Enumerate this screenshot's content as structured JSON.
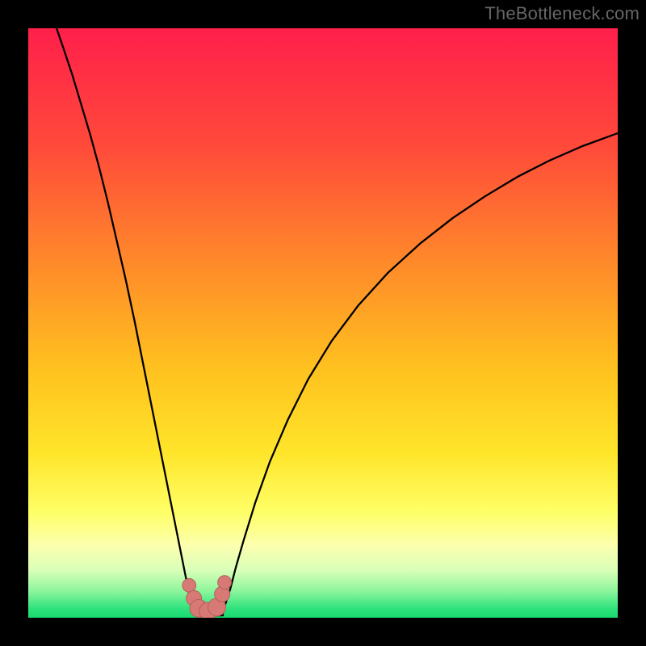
{
  "watermark": "TheBottleneck.com",
  "colors": {
    "background": "#000000",
    "watermark": "#666666",
    "curve": "#000000",
    "marker_fill": "#D77A76",
    "marker_stroke": "#B75E5A",
    "gradient_stops": [
      {
        "offset": 0.0,
        "color": "#FF1F4B"
      },
      {
        "offset": 0.2,
        "color": "#FF4A3A"
      },
      {
        "offset": 0.4,
        "color": "#FF8A2A"
      },
      {
        "offset": 0.58,
        "color": "#FFC21F"
      },
      {
        "offset": 0.72,
        "color": "#FFE52A"
      },
      {
        "offset": 0.82,
        "color": "#FFFF66"
      },
      {
        "offset": 0.88,
        "color": "#FBFFB0"
      },
      {
        "offset": 0.92,
        "color": "#D8FFB8"
      },
      {
        "offset": 0.955,
        "color": "#8CF59C"
      },
      {
        "offset": 0.985,
        "color": "#2EE27C"
      },
      {
        "offset": 1.0,
        "color": "#18D96F"
      }
    ]
  },
  "chart_data": {
    "type": "line",
    "title": "",
    "xlabel": "",
    "ylabel": "",
    "xlim": [
      0,
      1
    ],
    "ylim": [
      0,
      1
    ],
    "left_curve": [
      {
        "x": 0.048,
        "y": 1.0
      },
      {
        "x": 0.06,
        "y": 0.965
      },
      {
        "x": 0.075,
        "y": 0.92
      },
      {
        "x": 0.09,
        "y": 0.87
      },
      {
        "x": 0.105,
        "y": 0.82
      },
      {
        "x": 0.12,
        "y": 0.765
      },
      {
        "x": 0.135,
        "y": 0.705
      },
      {
        "x": 0.15,
        "y": 0.64
      },
      {
        "x": 0.165,
        "y": 0.575
      },
      {
        "x": 0.18,
        "y": 0.505
      },
      {
        "x": 0.195,
        "y": 0.43
      },
      {
        "x": 0.21,
        "y": 0.355
      },
      {
        "x": 0.225,
        "y": 0.28
      },
      {
        "x": 0.24,
        "y": 0.205
      },
      {
        "x": 0.255,
        "y": 0.13
      },
      {
        "x": 0.262,
        "y": 0.095
      },
      {
        "x": 0.268,
        "y": 0.065
      },
      {
        "x": 0.272,
        "y": 0.045
      },
      {
        "x": 0.277,
        "y": 0.025
      },
      {
        "x": 0.282,
        "y": 0.012
      }
    ],
    "right_curve": [
      {
        "x": 0.33,
        "y": 0.012
      },
      {
        "x": 0.335,
        "y": 0.025
      },
      {
        "x": 0.343,
        "y": 0.05
      },
      {
        "x": 0.352,
        "y": 0.085
      },
      {
        "x": 0.365,
        "y": 0.13
      },
      {
        "x": 0.385,
        "y": 0.195
      },
      {
        "x": 0.41,
        "y": 0.265
      },
      {
        "x": 0.44,
        "y": 0.335
      },
      {
        "x": 0.475,
        "y": 0.405
      },
      {
        "x": 0.515,
        "y": 0.47
      },
      {
        "x": 0.56,
        "y": 0.53
      },
      {
        "x": 0.61,
        "y": 0.585
      },
      {
        "x": 0.665,
        "y": 0.635
      },
      {
        "x": 0.72,
        "y": 0.678
      },
      {
        "x": 0.775,
        "y": 0.715
      },
      {
        "x": 0.83,
        "y": 0.748
      },
      {
        "x": 0.885,
        "y": 0.776
      },
      {
        "x": 0.94,
        "y": 0.8
      },
      {
        "x": 1.0,
        "y": 0.822
      }
    ],
    "floor_y": 0.004,
    "floor_x": [
      0.282,
      0.33
    ],
    "markers": [
      {
        "x": 0.273,
        "y": 0.055,
        "r": 0.0115
      },
      {
        "x": 0.281,
        "y": 0.033,
        "r": 0.013
      },
      {
        "x": 0.289,
        "y": 0.016,
        "r": 0.015
      },
      {
        "x": 0.305,
        "y": 0.011,
        "r": 0.015
      },
      {
        "x": 0.32,
        "y": 0.018,
        "r": 0.015
      },
      {
        "x": 0.329,
        "y": 0.04,
        "r": 0.013
      },
      {
        "x": 0.333,
        "y": 0.06,
        "r": 0.0115
      }
    ]
  }
}
